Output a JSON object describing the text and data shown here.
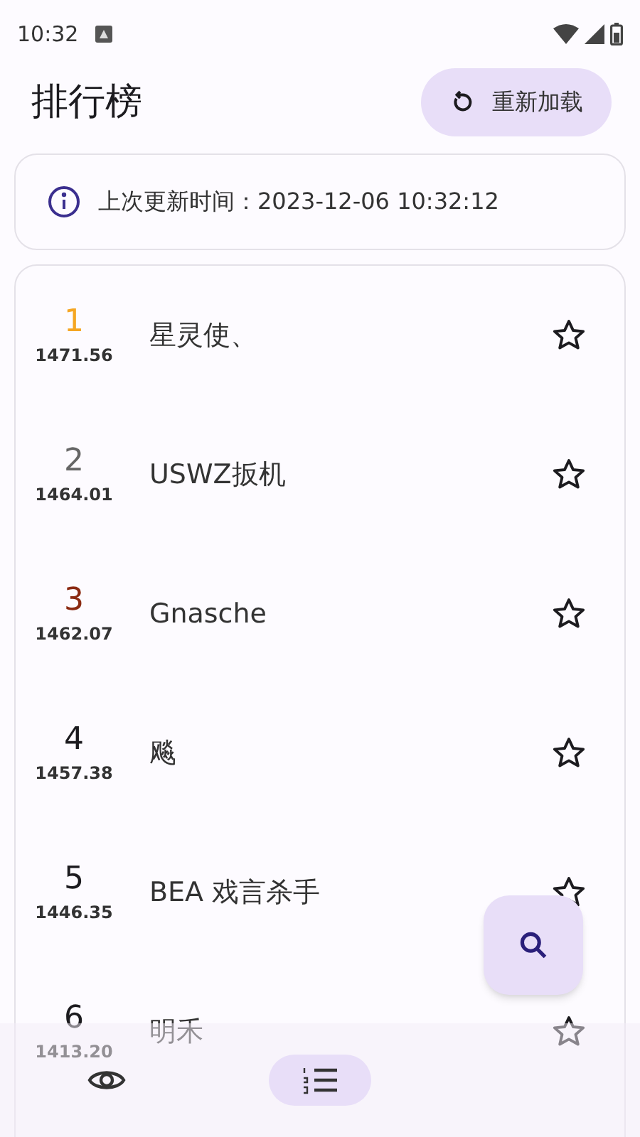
{
  "status_bar": {
    "time": "10:32"
  },
  "header": {
    "title": "排行榜",
    "reload_button": "重新加载"
  },
  "info": {
    "text": "上次更新时间：2023-12-06 10:32:12"
  },
  "ranking": [
    {
      "rank": "1",
      "score": "1471.56",
      "name": "星灵使、",
      "color": "#f5a623",
      "starred": false
    },
    {
      "rank": "2",
      "score": "1464.01",
      "name": "USWZ扳机",
      "color": "#666666",
      "starred": false
    },
    {
      "rank": "3",
      "score": "1462.07",
      "name": "Gnasche",
      "color": "#8b2a12",
      "starred": false
    },
    {
      "rank": "4",
      "score": "1457.38",
      "name": "飚",
      "color": "#1c1b1f",
      "starred": false
    },
    {
      "rank": "5",
      "score": "1446.35",
      "name": "BEA 戏言杀手",
      "color": "#1c1b1f",
      "starred": false
    },
    {
      "rank": "6",
      "score": "1413.20",
      "name": "明禾",
      "color": "#1c1b1f",
      "starred": false
    }
  ],
  "bottom_nav": [
    {
      "kind": "eye",
      "selected": false
    },
    {
      "kind": "list",
      "selected": true
    }
  ]
}
